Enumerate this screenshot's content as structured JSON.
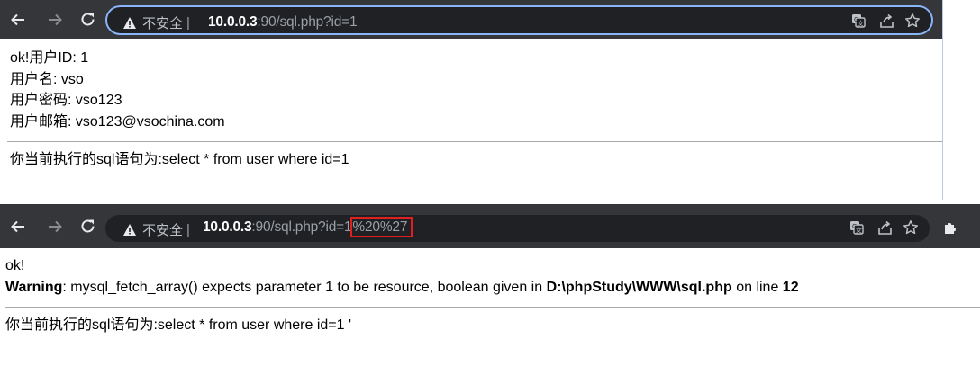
{
  "screenshot1": {
    "address_bar": {
      "security_label": "不安全",
      "separator": "|",
      "host": "10.0.0.3",
      "path": ":90/sql.php?id=1"
    },
    "page": {
      "ok_line": "ok!用户ID: 1",
      "username_line": "用户名: vso",
      "password_line": "用户密码: vso123",
      "email_line": "用户邮箱: vso123@vsochina.com",
      "sql_line": "你当前执行的sql语句为:select * from user where id=1"
    }
  },
  "screenshot2": {
    "address_bar": {
      "security_label": "不安全",
      "separator": "|",
      "host": "10.0.0.3",
      "path": ":90/sql.php?id=1",
      "highlighted": "%20%27"
    },
    "page": {
      "ok_line": "ok!",
      "warning_label": "Warning",
      "warning_message": ": mysql_fetch_array() expects parameter 1 to be resource, boolean given in ",
      "warning_file": "D:\\phpStudy\\WWW\\sql.php",
      "warning_online": " on line ",
      "warning_line_number": "12",
      "sql_line": "你当前执行的sql语句为:select * from user where id=1 '"
    }
  },
  "icons": [
    "back-icon",
    "forward-icon",
    "reload-icon",
    "not-secure-warning-icon",
    "translate-icon",
    "share-icon",
    "bookmark-star-icon",
    "extensions-icon"
  ],
  "colors": {
    "toolbar": "#35363a",
    "omnibox": "#202124",
    "focus_ring": "#8ab4f8",
    "highlight_box": "#e02020"
  }
}
